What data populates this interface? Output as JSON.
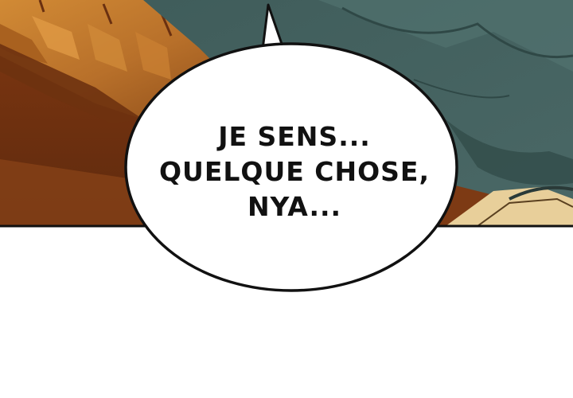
{
  "speech_bubble": {
    "lines": [
      "JE SENS...",
      "QUELQUE CHOSE,",
      "NYA..."
    ]
  },
  "colors": {
    "panel_border": "#111111",
    "bubble_fill": "#ffffff",
    "cloth_teal": "#466360",
    "cloth_teal_dark": "#2f4846",
    "wood_orange": "#c07a2a",
    "wood_dark": "#7a3a12",
    "skin_tan": "#e8cf9a"
  }
}
